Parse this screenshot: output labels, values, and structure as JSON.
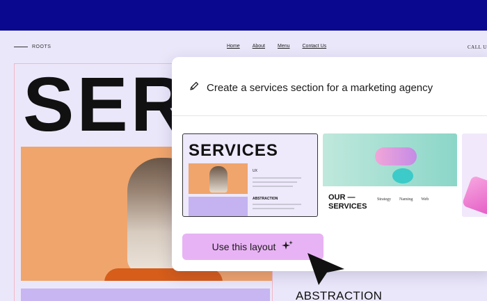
{
  "site": {
    "brand": "ROOTS",
    "nav": [
      "Home",
      "About",
      "Menu",
      "Contact Us"
    ],
    "callus": "CALL US",
    "hero_title": "SER",
    "section_label": "ABSTRACTION"
  },
  "panel": {
    "prompt": "Create a services section for a marketing agency",
    "cta_label": "Use this layout",
    "thumbs": {
      "t1_title": "SERVICES",
      "t1_label1": "UX",
      "t1_label2": "ABSTRACTION",
      "t2_title_line1": "OUR",
      "t2_title_line2": "SERVICES",
      "t2_cols": [
        "Strategy",
        "Naming",
        "Web"
      ]
    }
  },
  "colors": {
    "topbar": "#09088f",
    "accent_button": "#e8b3f4",
    "photo_bg": "#f0a56c",
    "lilac": "#c7b6f2"
  },
  "icons": {
    "prompt_icon": "pencil-icon",
    "cta_icon": "sparkle-icon",
    "cursor": "mouse-pointer-icon"
  }
}
